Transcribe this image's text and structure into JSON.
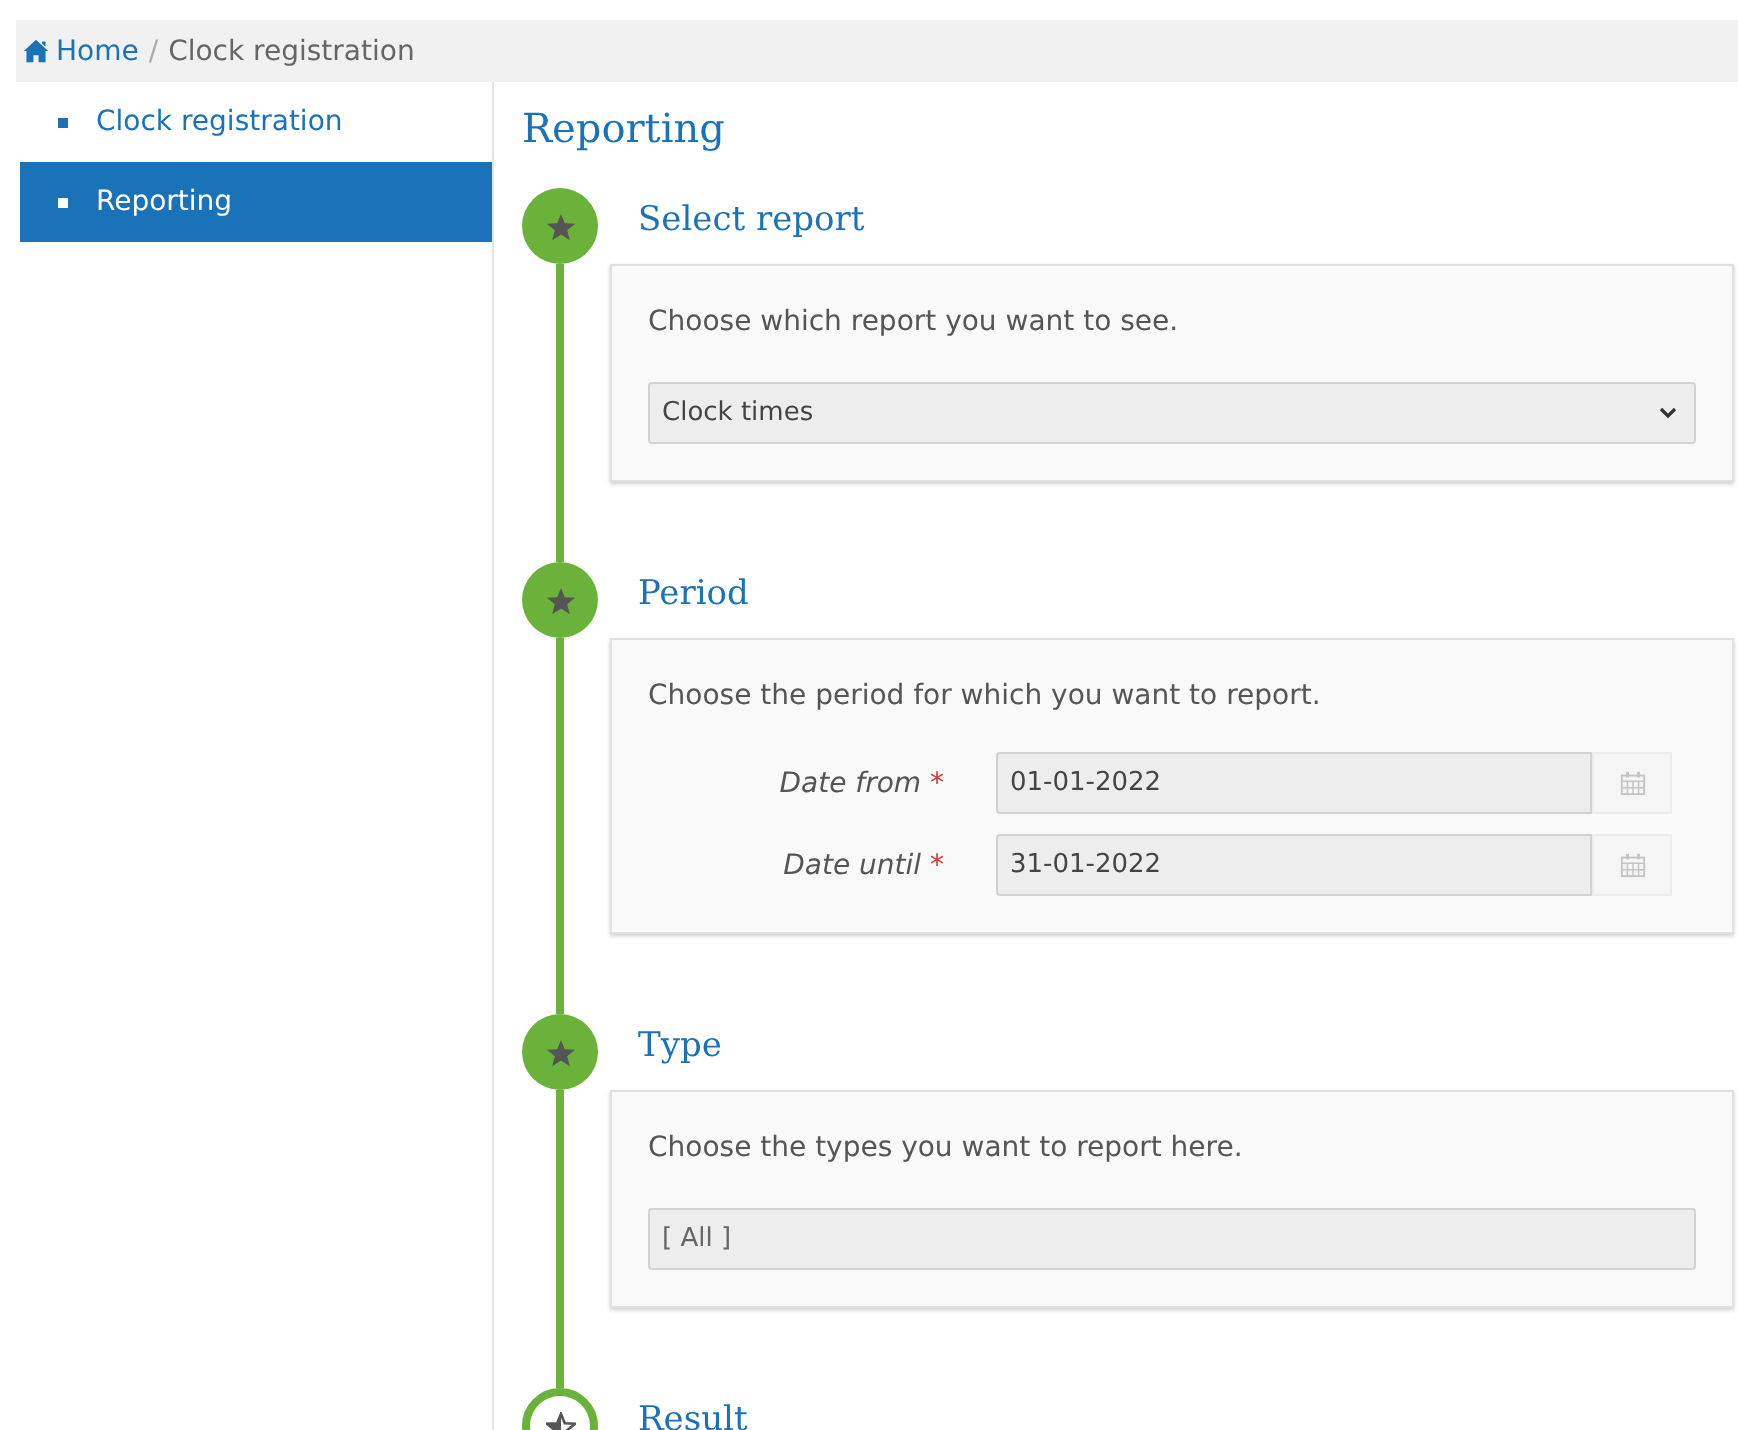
{
  "breadcrumb": [
    {
      "label": "Home",
      "kind": "home"
    },
    {
      "separator": "/",
      "label": "Clock registration",
      "kind": "current"
    }
  ],
  "sidebar": {
    "items": [
      {
        "label": "Clock registration",
        "selected": false
      },
      {
        "label": "Reporting",
        "selected": true
      }
    ]
  },
  "page_title": "Reporting",
  "steps": [
    {
      "title": "Select report",
      "done": true,
      "kind": "select",
      "description": "Choose which report you want to see.",
      "value": "Clock times"
    },
    {
      "title": "Period",
      "done": true,
      "kind": "dates",
      "description": "Choose the period for which you want to report.",
      "fields": [
        {
          "label": "Date from",
          "required_mark": "*",
          "value": "01-01-2022"
        },
        {
          "label": "Date until",
          "required_mark": "*",
          "value": "31-01-2022"
        }
      ]
    },
    {
      "title": "Type",
      "done": true,
      "kind": "multiselect",
      "description": "Choose the types you want to report here.",
      "value": "[ All ]"
    },
    {
      "title": "Result",
      "done": false,
      "kind": "result"
    }
  ]
}
